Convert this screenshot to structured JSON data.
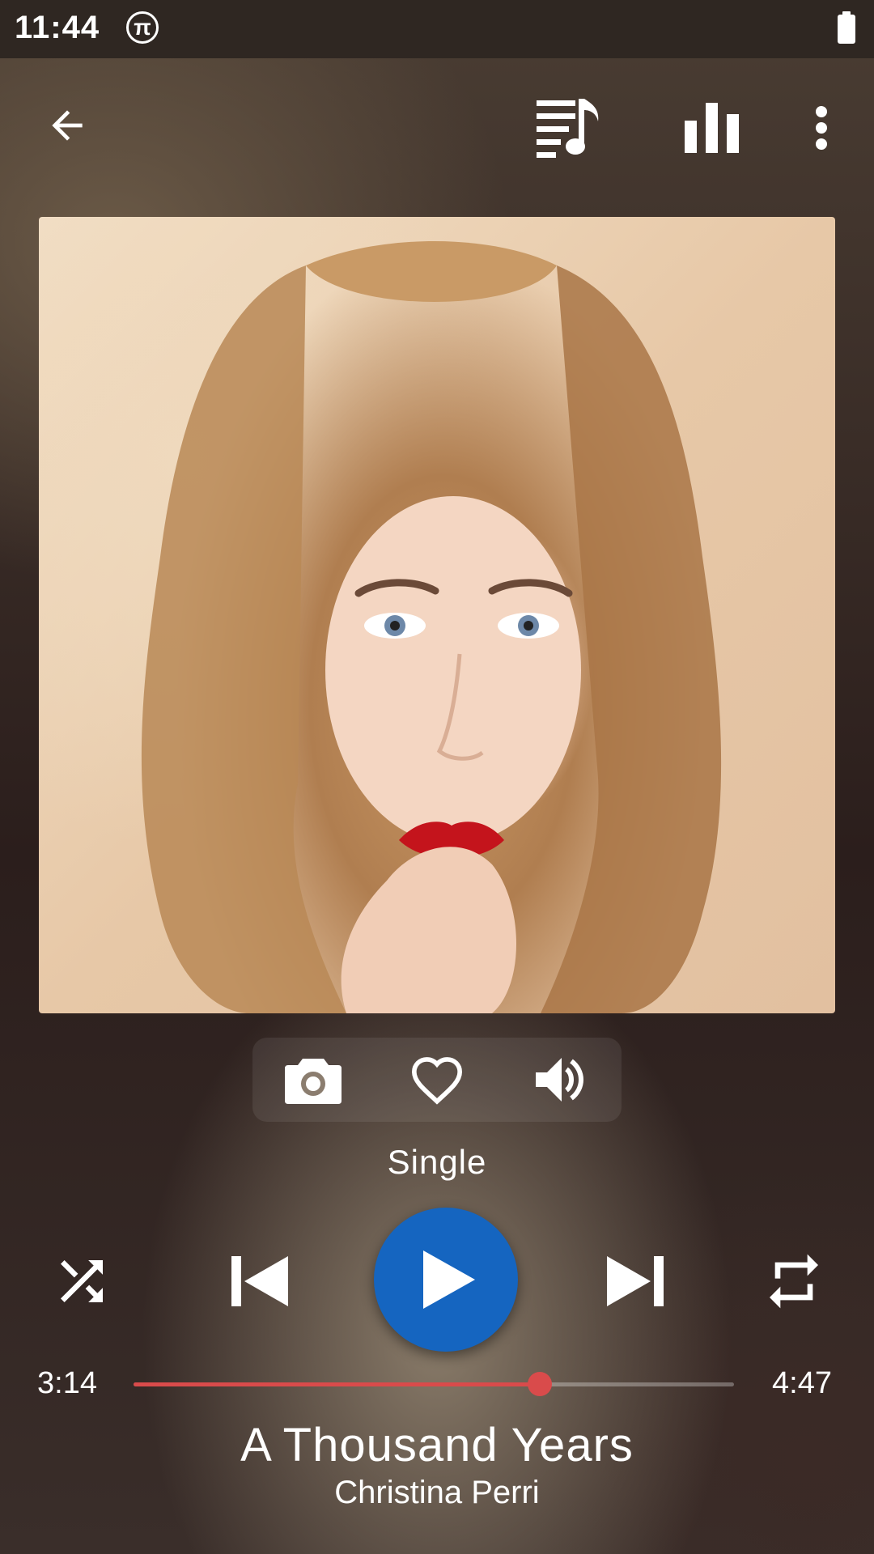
{
  "status_bar": {
    "time": "11:44",
    "notification_icon": "pi-icon",
    "battery_icon": "battery-icon"
  },
  "toolbar": {
    "back_icon": "arrow-left-icon",
    "queue_icon": "playlist-music-icon",
    "equalizer_icon": "equalizer-icon",
    "more_icon": "more-vert-icon"
  },
  "now_playing": {
    "album": "Single",
    "title": "A Thousand Years",
    "artist": "Christina Perri",
    "current_time": "3:14",
    "total_time": "4:47",
    "progress_fraction": 0.676
  },
  "actions": {
    "icons": [
      "camera-icon",
      "heart-outline-icon",
      "volume-icon"
    ]
  },
  "controls": {
    "icons": [
      "shuffle-icon",
      "skip-previous-icon",
      "play-icon",
      "skip-next-icon",
      "repeat-icon"
    ]
  },
  "colors": {
    "accent_play": "#1565c0",
    "progress": "#d94b4b",
    "status_bar": "#2f2722"
  }
}
